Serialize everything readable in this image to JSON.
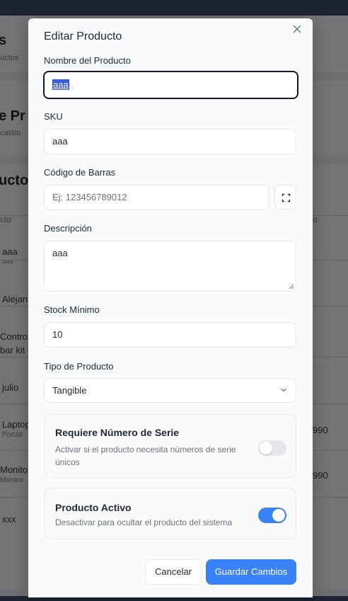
{
  "background": {
    "partial_texts": [
      {
        "text": "s"
      },
      {
        "text": "uctos"
      },
      {
        "text": "e Pr"
      },
      {
        "text": "catálo"
      },
      {
        "text": "uctos"
      },
      {
        "text": "cto"
      },
      {
        "text": "o"
      },
      {
        "text": "aaa"
      },
      {
        "text": "aaa"
      },
      {
        "text": "Alejan"
      },
      {
        "text": "Contro"
      },
      {
        "text": "bar kit"
      },
      {
        "text": "julio"
      },
      {
        "text": "Laptop"
      },
      {
        "text": "Portáti"
      },
      {
        "text": "990"
      },
      {
        "text": "Monito"
      },
      {
        "text": "Monitor"
      },
      {
        "text": "990"
      },
      {
        "text": "xxx"
      }
    ]
  },
  "modal": {
    "title": "Editar Producto",
    "close_icon": "close-icon",
    "fields": {
      "name": {
        "label": "Nombre del Producto",
        "value": "aaa"
      },
      "sku": {
        "label": "SKU",
        "value": "aaa"
      },
      "barcode": {
        "label": "Código de Barras",
        "placeholder": "Ej: 123456789012",
        "scan_icon": "scan-icon"
      },
      "description": {
        "label": "Descripción",
        "value": "aaa"
      },
      "min_stock": {
        "label": "Stock Mínimo",
        "value": "10"
      },
      "product_type": {
        "label": "Tipo de Producto",
        "selected": "Tangible"
      }
    },
    "serial_card": {
      "title": "Requiere Número de Serie",
      "description": "Activar si el producto necesita números de serie únicos",
      "enabled": false
    },
    "active_card": {
      "title": "Producto Activo",
      "description": "Desactivar para ocultar el producto del sistema",
      "enabled": true
    },
    "buttons": {
      "cancel": "Cancelar",
      "save": "Guardar Cambios"
    },
    "colors": {
      "primary": "#3b82f6",
      "toggle_off": "#e5e7eb"
    }
  }
}
